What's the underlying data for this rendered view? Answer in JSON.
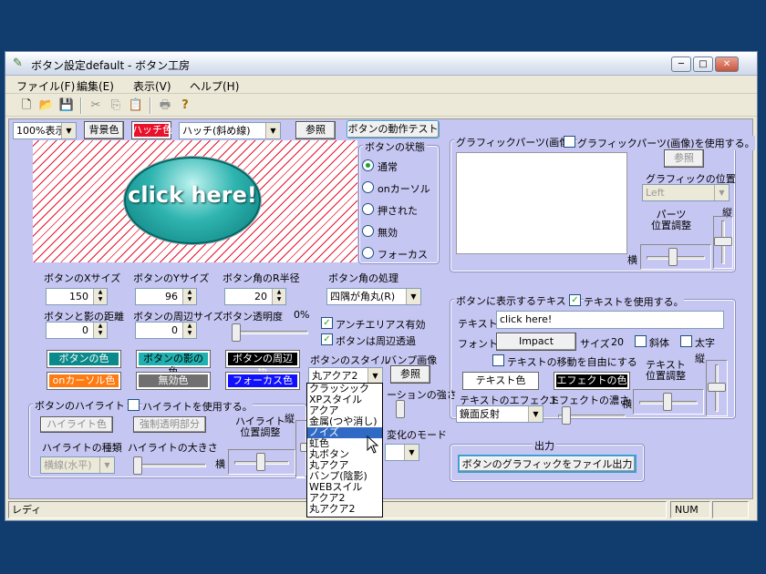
{
  "window": {
    "title": "ボタン設定default - ボタン工房",
    "min": "─",
    "max": "□",
    "close": "✕"
  },
  "menu": [
    "ファイル(F)",
    "編集(E)",
    "表示(V)",
    "ヘルプ(H)"
  ],
  "toolbar": {
    "new": "🗋",
    "open": "📂",
    "save": "💾",
    "cut": "✂",
    "copy": "⎘",
    "paste": "📋",
    "print": "🖶",
    "help": "?"
  },
  "top": {
    "zoom": "100%表示",
    "bg_btn": "背景色",
    "hatch_color_btn": "ハッチ色",
    "hatch_combo": "ハッチ(斜め線)",
    "ref_btn": "参照",
    "test_btn": "ボタンの動作テスト"
  },
  "preview": {
    "text": "click here!"
  },
  "state": {
    "title": "ボタンの状態",
    "options": [
      "通常",
      "onカーソル",
      "押された",
      "無効",
      "フォーカス"
    ],
    "selected": 0
  },
  "graphic": {
    "group_title": "グラフィックパーツ(画像)",
    "use_label": "グラフィックパーツ(画像)を使用する。",
    "ref_btn": "参照",
    "pos_label": "グラフィックの位置",
    "pos_value": "Left",
    "parts_adjust": "パーツ\n位置調整",
    "vertical": "縦",
    "horizontal": "横"
  },
  "size": {
    "x_label": "ボタンのXサイズ",
    "x": "150",
    "y_label": "ボタンのYサイズ",
    "y": "96",
    "r_label": "ボタン角のR半径",
    "r": "20",
    "corner_label": "ボタン角の処理",
    "corner": "四隅が角丸(R)",
    "shadow_label": "ボタンと影の距離",
    "shadow": "0",
    "margin_label": "ボタンの周辺サイズ",
    "margin": "0",
    "alpha_label": "ボタン透明度",
    "alpha": "0%"
  },
  "checks": {
    "antialias": "アンチエリアス有効",
    "transparent": "ボタンは周辺透過"
  },
  "colors": {
    "btn": "ボタンの色",
    "shadow": "ボタンの影の色",
    "margin": "ボタンの周辺色",
    "oncursor": "onカーソル色",
    "disabled": "無効色",
    "focus": "フォーカス色"
  },
  "style": {
    "label": "ボタンのスタイル",
    "value": "丸アクア2",
    "bump_label": "バンプ画像",
    "bump_ref": "参照",
    "gradation_label": "ーションの強さ",
    "mode_label": "変化のモード"
  },
  "dropdown": [
    "クラッシック",
    "XPスタイル",
    "アクア",
    "金属(つや消し)",
    "ノイズ",
    "虹色",
    "丸ボタン",
    "丸アクア",
    "バンプ(陰影)",
    "WEBスイル",
    "アクア2",
    "丸アクア2"
  ],
  "dropdown_selected": 4,
  "highlight": {
    "group_title": "ボタンのハイライト",
    "use_label": "ハイライトを使用する。",
    "color_btn": "ハイライト色",
    "tmp_btn": "強制透明部分",
    "kind_label": "ハイライトの種類",
    "kind_value": "横線(水平)",
    "size_label": "ハイライトの大きさ",
    "pos_label": "ハイライト\n位置調整",
    "vertical": "縦",
    "horizontal": "横"
  },
  "text": {
    "group_title": "ボタンに表示するテキスト",
    "use_label": "テキストを使用する。",
    "text_label": "テキスト",
    "text_value": "click here!",
    "font_label": "フォント",
    "font_btn": "Impact",
    "size_label": "サイズ",
    "size_value": "20",
    "italic": "斜体",
    "bold": "太字",
    "free_move": "テキストの移動を自由にする",
    "color_btn": "テキスト色",
    "effect_color_btn": "エフェクトの色",
    "adjust_label": "テキスト\n位置調整",
    "effect_label": "テキストのエフェクト",
    "effect_value": "鏡面反射",
    "depth_label": "エフェクトの濃さ",
    "vertical": "縦",
    "horizontal": "横"
  },
  "output": {
    "group_title": "出力",
    "btn": "ボタンのグラフィックをファイル出力"
  },
  "status": {
    "text": "レディ",
    "num": "NUM"
  }
}
